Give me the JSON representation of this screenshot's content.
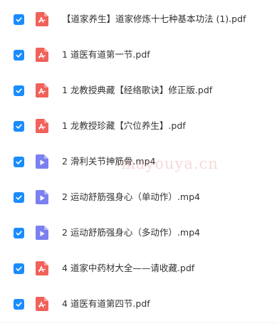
{
  "colors": {
    "checkbox": "#1a8cff",
    "pdf_icon": "#f0625a",
    "video_icon": "#7b80f0",
    "text": "#333333"
  },
  "files": [
    {
      "name": "【道家养生】道家修炼十七种基本功法 (1).pdf",
      "type": "pdf",
      "icon": "pdf-icon",
      "checked": true
    },
    {
      "name": "1 道医有道第一节.pdf",
      "type": "pdf",
      "icon": "pdf-icon",
      "checked": true
    },
    {
      "name": "1 龙教授典藏【经络歌诀】修正版.pdf",
      "type": "pdf",
      "icon": "pdf-icon",
      "checked": true
    },
    {
      "name": "1 龙教授珍藏【穴位养生】.pdf",
      "type": "pdf",
      "icon": "pdf-icon",
      "checked": true
    },
    {
      "name": "2 滑利关节抻筋骨.mp4",
      "type": "mp4",
      "icon": "video-icon",
      "checked": true
    },
    {
      "name": "2 运动舒筋强身心（单动作）.mp4",
      "type": "mp4",
      "icon": "video-icon",
      "checked": true
    },
    {
      "name": "2 运动舒筋强身心（多动作）.mp4",
      "type": "mp4",
      "icon": "video-icon",
      "checked": true
    },
    {
      "name": "4 道家中药材大全——请收藏.pdf",
      "type": "pdf",
      "icon": "pdf-icon",
      "checked": true
    },
    {
      "name": "4 道医有道第四节.pdf",
      "type": "pdf",
      "icon": "pdf-icon",
      "checked": true
    }
  ],
  "watermark": "mayouya.cn"
}
